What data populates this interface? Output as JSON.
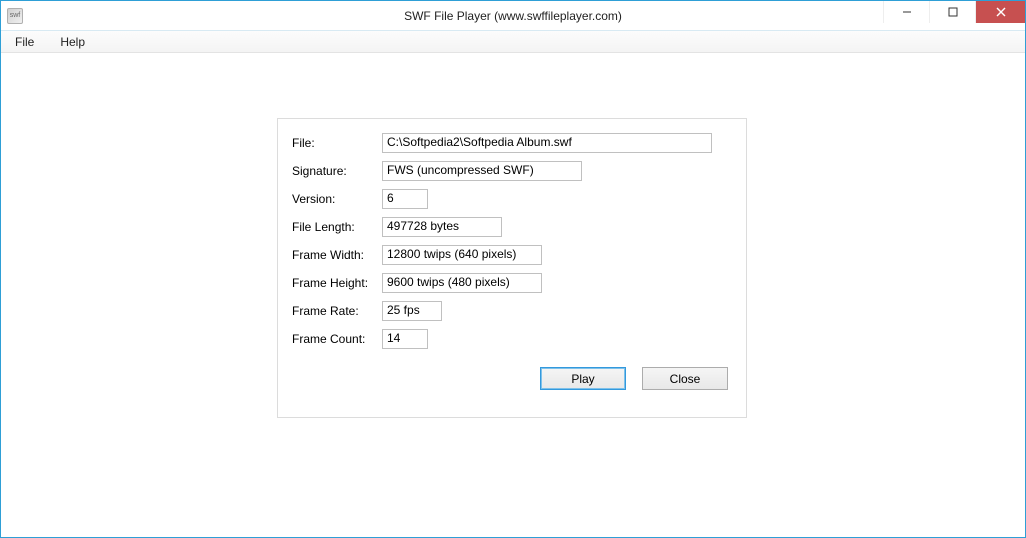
{
  "window": {
    "title": "SWF File Player (www.swffileplayer.com)"
  },
  "menu": {
    "file": "File",
    "help": "Help"
  },
  "labels": {
    "file": "File:",
    "signature": "Signature:",
    "version": "Version:",
    "fileLength": "File Length:",
    "frameWidth": "Frame Width:",
    "frameHeight": "Frame Height:",
    "frameRate": "Frame Rate:",
    "frameCount": "Frame Count:"
  },
  "values": {
    "file": "C:\\Softpedia2\\Softpedia Album.swf",
    "signature": "FWS (uncompressed SWF)",
    "version": "6",
    "fileLength": "497728 bytes",
    "frameWidth": "12800 twips (640 pixels)",
    "frameHeight": "9600 twips (480 pixels)",
    "frameRate": "25 fps",
    "frameCount": "14"
  },
  "buttons": {
    "play": "Play",
    "close": "Close"
  }
}
